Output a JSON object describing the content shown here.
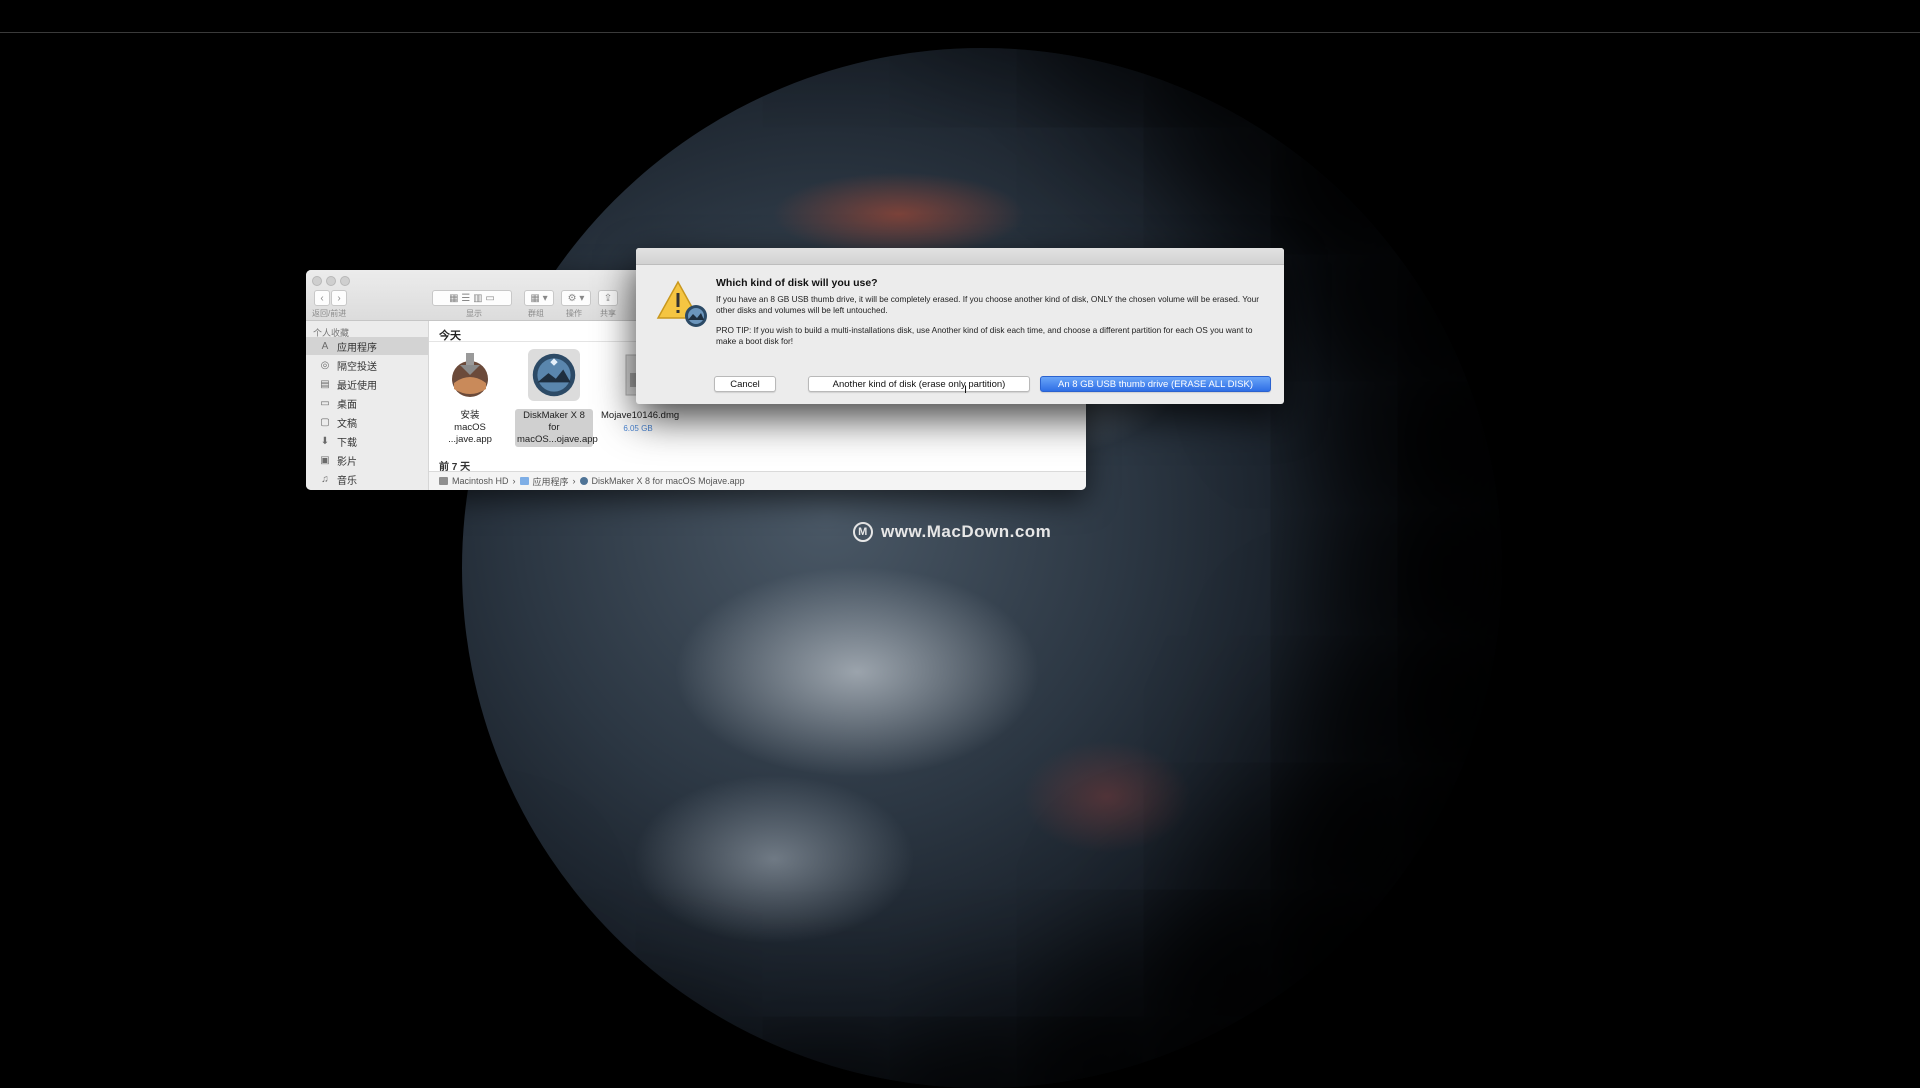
{
  "finder": {
    "nav_label": "返回/前进",
    "toolbar_labels": {
      "display": "显示",
      "group": "群组",
      "action": "操作",
      "share": "共享"
    },
    "sidebar_header": "个人收藏",
    "sidebar_items": [
      {
        "label": "应用程序",
        "icon": "apps-icon",
        "active": true
      },
      {
        "label": "隔空投送",
        "icon": "airdrop-icon"
      },
      {
        "label": "最近使用",
        "icon": "recents-icon"
      },
      {
        "label": "桌面",
        "icon": "desktop-icon"
      },
      {
        "label": "文稿",
        "icon": "documents-icon"
      },
      {
        "label": "下载",
        "icon": "downloads-icon"
      },
      {
        "label": "影片",
        "icon": "movies-icon"
      },
      {
        "label": "音乐",
        "icon": "music-icon"
      }
    ],
    "section_today": "今天",
    "section_prev": "前 7 天",
    "files": [
      {
        "line1": "安装",
        "line2": "macOS ...jave.app"
      },
      {
        "line1": "DiskMaker X 8 for",
        "line2": "macOS...ojave.app",
        "selected": true
      },
      {
        "line1": "Mojave10146.dmg",
        "size": "6.05 GB"
      }
    ],
    "path": [
      "Macintosh HD",
      "应用程序",
      "DiskMaker X 8 for macOS Mojave.app"
    ]
  },
  "dialog": {
    "title": "Which kind of disk will you use?",
    "body1": "If you have an 8 GB USB thumb drive, it will be completely erased. If you choose another kind of disk, ONLY the chosen volume will be erased. Your other disks and volumes will be left untouched.",
    "body2": "PRO TIP: If you wish to build a multi-installations disk, use Another kind of disk each time, and choose a different partition for each OS you want to make a boot disk for!",
    "buttons": {
      "cancel": "Cancel",
      "other": "Another kind of disk (erase only partition)",
      "usb": "An 8 GB USB thumb drive (ERASE ALL DISK)"
    },
    "accent_color": "#3478f0"
  },
  "watermark": "www.MacDown.com"
}
